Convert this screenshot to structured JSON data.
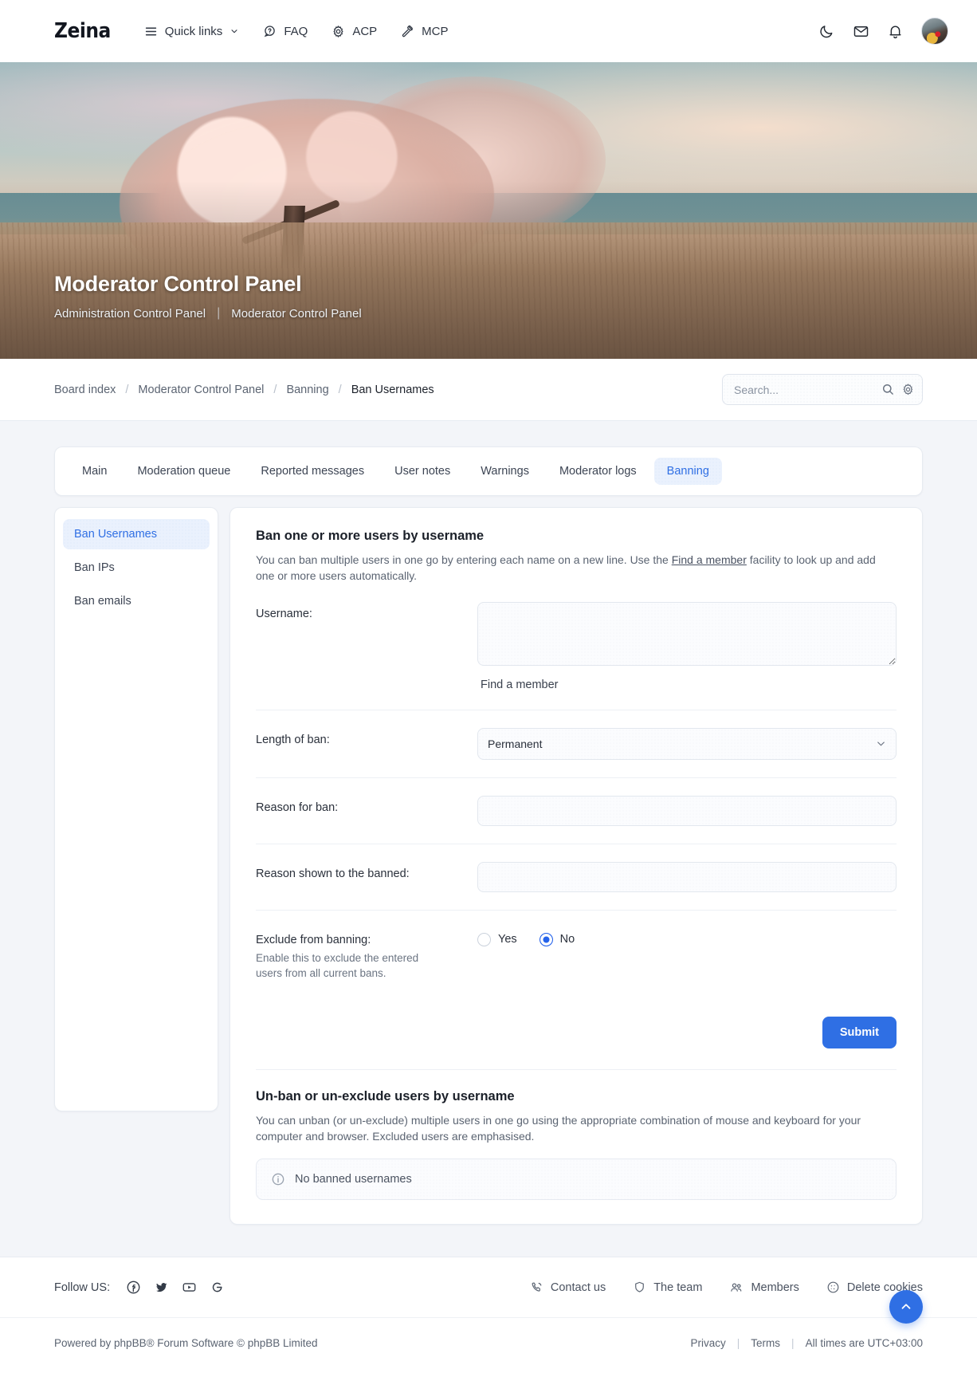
{
  "header": {
    "brand": "Zeina",
    "nav": [
      {
        "label": "Quick links",
        "icon": "hamburger-icon",
        "caret": true
      },
      {
        "label": "FAQ",
        "icon": "question-bubble-icon",
        "caret": false
      },
      {
        "label": "ACP",
        "icon": "gear-icon",
        "caret": false
      },
      {
        "label": "MCP",
        "icon": "gavel-icon",
        "caret": false
      }
    ],
    "right_icons": [
      {
        "name": "dark-mode-moon-icon"
      },
      {
        "name": "messages-envelope-icon"
      },
      {
        "name": "notifications-bell-icon"
      },
      {
        "name": "user-avatar"
      }
    ]
  },
  "hero": {
    "title": "Moderator Control Panel",
    "links": [
      {
        "label": "Administration Control Panel"
      },
      {
        "label": "Moderator Control Panel"
      }
    ],
    "separator": "|"
  },
  "breadcrumb": {
    "items": [
      {
        "label": "Board index",
        "current": false
      },
      {
        "label": "Moderator Control Panel",
        "current": false
      },
      {
        "label": "Banning",
        "current": false
      },
      {
        "label": "Ban Usernames",
        "current": true
      }
    ],
    "separator": "/"
  },
  "search": {
    "placeholder": "Search...",
    "value": "",
    "search_icon": "magnifier-icon",
    "options_icon": "gear-icon"
  },
  "tabs": [
    {
      "label": "Main",
      "active": false
    },
    {
      "label": "Moderation queue",
      "active": false
    },
    {
      "label": "Reported messages",
      "active": false
    },
    {
      "label": "User notes",
      "active": false
    },
    {
      "label": "Warnings",
      "active": false
    },
    {
      "label": "Moderator logs",
      "active": false
    },
    {
      "label": "Banning",
      "active": true
    }
  ],
  "sidebar": {
    "items": [
      {
        "label": "Ban Usernames",
        "active": true
      },
      {
        "label": "Ban IPs",
        "active": false
      },
      {
        "label": "Ban emails",
        "active": false
      }
    ]
  },
  "form": {
    "title": "Ban one or more users by username",
    "desc_part1": "You can ban multiple users in one go by entering each name on a new line. Use the ",
    "desc_link": "Find a member",
    "desc_part2": " facility to look up and add one or more users automatically.",
    "username_label": "Username:",
    "username_value": "",
    "username_placeholder": "",
    "find_member_label": "Find a member",
    "length_label": "Length of ban:",
    "length_value": "Permanent",
    "length_options": [
      "Permanent"
    ],
    "reason_label": "Reason for ban:",
    "reason_value": "",
    "reason_shown_label": "Reason shown to the banned:",
    "reason_shown_value": "",
    "exclude_label": "Exclude from banning:",
    "exclude_hint": "Enable this to exclude the entered users from all current bans.",
    "exclude_options": [
      {
        "label": "Yes",
        "selected": false
      },
      {
        "label": "No",
        "selected": true
      }
    ],
    "submit_label": "Submit"
  },
  "unban": {
    "title": "Un-ban or un-exclude users by username",
    "desc": "You can unban (or un-exclude) multiple users in one go using the appropriate combination of mouse and keyboard for your computer and browser. Excluded users are emphasised.",
    "empty_icon": "info-circle-icon",
    "empty_text": "No banned usernames"
  },
  "footer": {
    "follow_label": "Follow US:",
    "socials": [
      {
        "name": "facebook-icon"
      },
      {
        "name": "twitter-icon"
      },
      {
        "name": "youtube-icon"
      },
      {
        "name": "google-icon"
      }
    ],
    "links": [
      {
        "label": "Contact us",
        "icon": "phone-icon"
      },
      {
        "label": "The team",
        "icon": "shield-icon"
      },
      {
        "label": "Members",
        "icon": "members-icon"
      },
      {
        "label": "Delete cookies",
        "icon": "cookie-icon"
      }
    ],
    "copyright": "Powered by phpBB® Forum Software © phpBB Limited",
    "legal": [
      {
        "label": "Privacy"
      },
      {
        "label": "Terms"
      }
    ],
    "timezone": "All times are UTC+03:00",
    "separator": "|",
    "to_top_icon": "chevron-up-icon"
  },
  "colors": {
    "accent": "#2f6fe4",
    "accent_soft": "#eaf1fd",
    "page_bg": "#f3f5f9",
    "card_bg": "#ffffff",
    "text": "#22262e",
    "muted": "#5b6472"
  }
}
